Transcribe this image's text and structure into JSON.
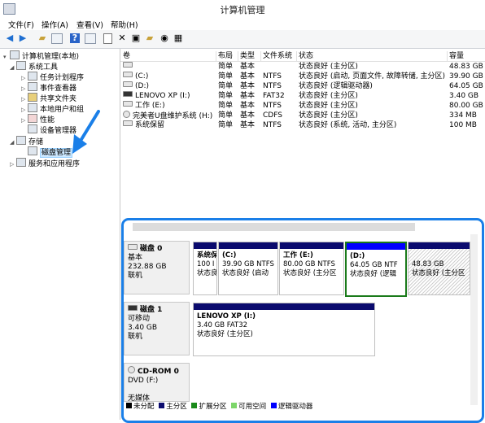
{
  "window": {
    "title": "计算机管理"
  },
  "menu": [
    "文件(F)",
    "操作(A)",
    "查看(V)",
    "帮助(H)"
  ],
  "toolbar_icons": [
    "back-icon",
    "forward-icon",
    "up-folder-icon",
    "show-tree-icon",
    "help-icon",
    "view-icon",
    "properties-icon",
    "delete-icon",
    "open-icon",
    "new-folder-icon",
    "search-icon",
    "settings-icon"
  ],
  "tree": [
    {
      "label": "计算机管理(本地)",
      "level": 0,
      "exp": "▾"
    },
    {
      "label": "系统工具",
      "level": 1,
      "exp": "◢"
    },
    {
      "label": "任务计划程序",
      "level": 2,
      "exp": "▷"
    },
    {
      "label": "事件查看器",
      "level": 2,
      "exp": "▷"
    },
    {
      "label": "共享文件夹",
      "level": 2,
      "exp": "▷"
    },
    {
      "label": "本地用户和组",
      "level": 2,
      "exp": "▷"
    },
    {
      "label": "性能",
      "level": 2,
      "exp": "▷"
    },
    {
      "label": "设备管理器",
      "level": 2,
      "exp": ""
    },
    {
      "label": "存储",
      "level": 1,
      "exp": "◢"
    },
    {
      "label": "磁盘管理",
      "level": 2,
      "exp": "",
      "selected": true
    },
    {
      "label": "服务和应用程序",
      "level": 1,
      "exp": "▷"
    }
  ],
  "volume_list": {
    "headers": [
      "卷",
      "布局",
      "类型",
      "文件系统",
      "状态",
      "容量"
    ],
    "rows": [
      [
        "",
        "简单",
        "基本",
        "",
        "状态良好 (主分区)",
        "48.83 GB"
      ],
      [
        "(C:)",
        "简单",
        "基本",
        "NTFS",
        "状态良好 (启动, 页面文件, 故障转储, 主分区)",
        "39.90 GB"
      ],
      [
        "(D:)",
        "简单",
        "基本",
        "NTFS",
        "状态良好 (逻辑驱动器)",
        "64.05 GB"
      ],
      [
        "LENOVO XP (I:)",
        "简单",
        "基本",
        "FAT32",
        "状态良好 (主分区)",
        "3.40 GB"
      ],
      [
        "工作 (E:)",
        "简单",
        "基本",
        "NTFS",
        "状态良好 (主分区)",
        "80.00 GB"
      ],
      [
        "完美者U盘维护系统 (H:)",
        "简单",
        "基本",
        "CDFS",
        "状态良好 (主分区)",
        "334 MB"
      ],
      [
        "系统保留",
        "简单",
        "基本",
        "NTFS",
        "状态良好 (系统, 活动, 主分区)",
        "100 MB"
      ]
    ]
  },
  "disks": [
    {
      "name": "磁盘 0",
      "type": "基本",
      "size": "232.88 GB",
      "status": "联机",
      "partitions": [
        {
          "name": "系统保",
          "size": "100 I",
          "status": "状态良"
        },
        {
          "name": "(C:)",
          "size": "39.90 GB NTFS",
          "status": "状态良好 (启动"
        },
        {
          "name": "工作  (E:)",
          "size": "80.00 GB NTFS",
          "status": "状态良好 (主分区"
        },
        {
          "name": "(D:)",
          "size": "64.05 GB NTF",
          "status": "状态良好 (逻辑"
        },
        {
          "name": "",
          "size": "48.83 GB",
          "status": "状态良好 (主分区"
        }
      ]
    },
    {
      "name": "磁盘 1",
      "type": "可移动",
      "size": "3.40 GB",
      "status": "联机",
      "partitions": [
        {
          "name": "LENOVO XP  (I:)",
          "size": "3.40 GB FAT32",
          "status": "状态良好 (主分区)"
        }
      ]
    },
    {
      "name": "CD-ROM 0",
      "type": "DVD (F:)",
      "size": "",
      "status": "无媒体",
      "partitions": []
    }
  ],
  "legend": [
    {
      "label": "未分配",
      "color": "#000000"
    },
    {
      "label": "主分区",
      "color": "#0b0b6e"
    },
    {
      "label": "扩展分区",
      "color": "#1a8a1a"
    },
    {
      "label": "可用空间",
      "color": "#7dd66a"
    },
    {
      "label": "逻辑驱动器",
      "color": "#0000ff"
    }
  ]
}
